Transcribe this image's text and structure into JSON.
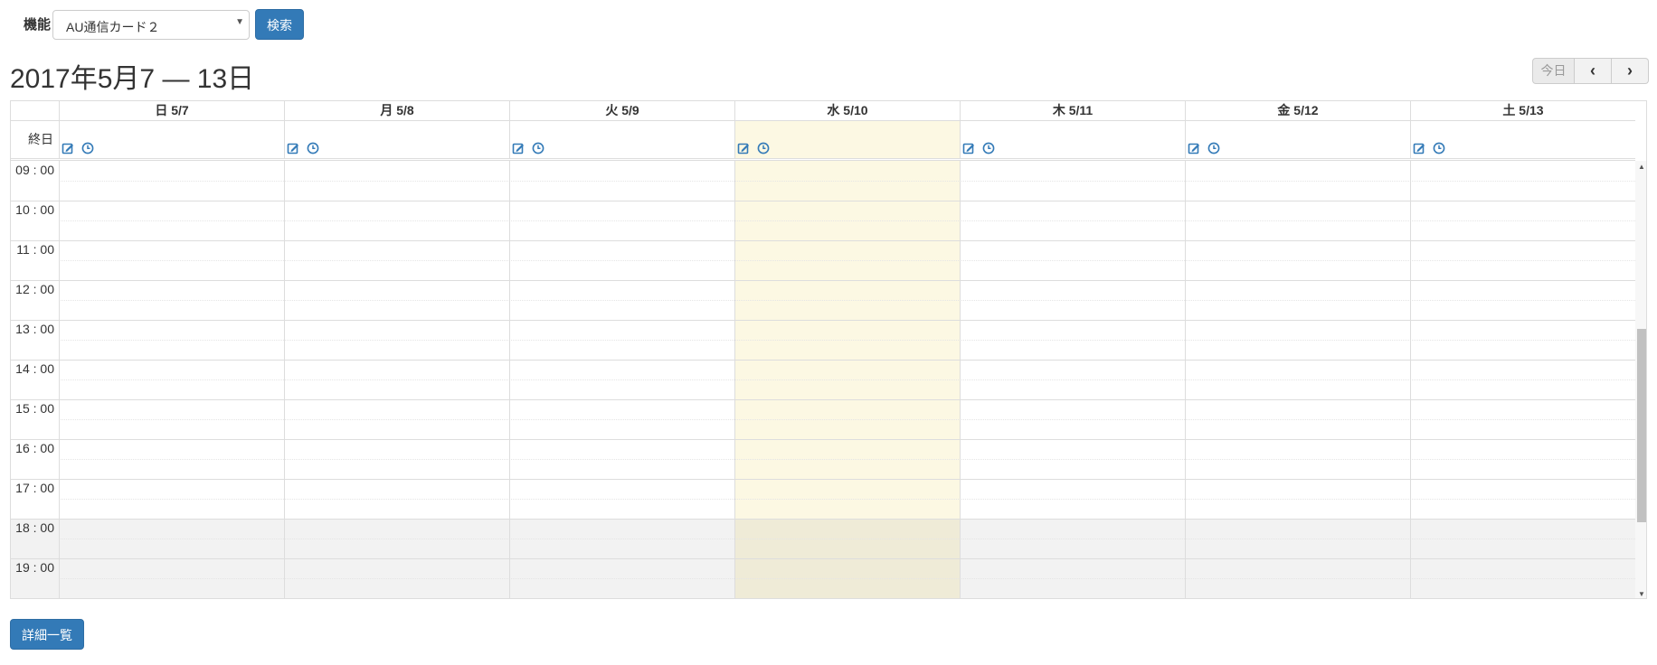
{
  "search": {
    "label": "機能",
    "selected": "AU通信カード２",
    "button": "検索"
  },
  "calendar": {
    "title": "2017年5月7 — 13日",
    "nav": {
      "today": "今日",
      "prev": "‹",
      "next": "›"
    },
    "days": [
      "日 5/7",
      "月 5/8",
      "火 5/9",
      "水 5/10",
      "木 5/11",
      "金 5/12",
      "土 5/13"
    ],
    "today_index": 3,
    "allday_label": "終日",
    "hours": [
      "09 : 00",
      "10 : 00",
      "11 : 00",
      "12 : 00",
      "13 : 00",
      "14 : 00",
      "15 : 00",
      "16 : 00",
      "17 : 00",
      "18 : 00",
      "19 : 00"
    ],
    "after_hours_start_index": 9
  },
  "footer": {
    "detail_button": "詳細一覧"
  },
  "colors": {
    "primary": "#337ab7",
    "today_bg": "#fcf8e3",
    "border": "#dddddd"
  },
  "icons": [
    "edit-icon",
    "clock-icon",
    "chevron-left-icon",
    "chevron-right-icon",
    "dropdown-arrow-icon"
  ]
}
